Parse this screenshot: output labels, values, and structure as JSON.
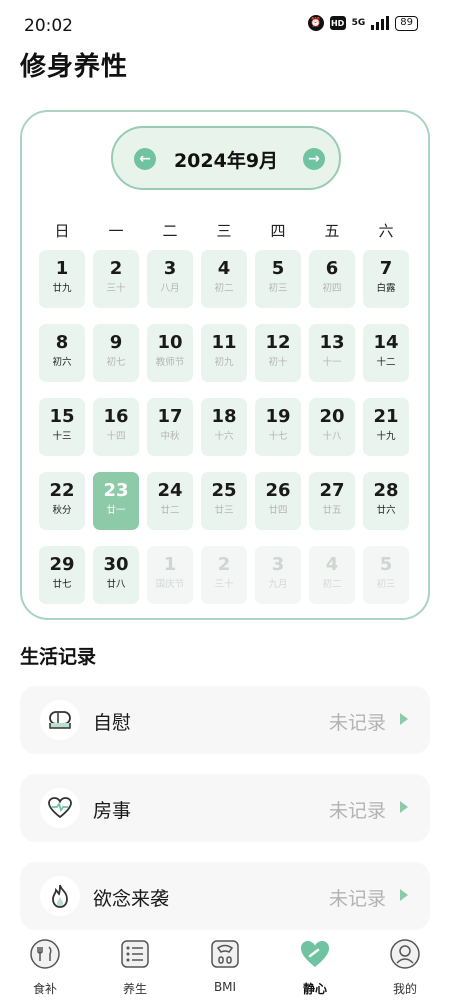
{
  "status_bar": {
    "time": "20:02",
    "hd": "HD",
    "network": "5G",
    "battery": "89"
  },
  "page_title": "修身养性",
  "calendar": {
    "month_label": "2024年9月",
    "weekdays": [
      "日",
      "一",
      "二",
      "三",
      "四",
      "五",
      "六"
    ],
    "weeks": [
      [
        {
          "day": "1",
          "lunar": "廿九"
        },
        {
          "day": "2",
          "lunar": "三十"
        },
        {
          "day": "3",
          "lunar": "八月"
        },
        {
          "day": "4",
          "lunar": "初二"
        },
        {
          "day": "5",
          "lunar": "初三"
        },
        {
          "day": "6",
          "lunar": "初四"
        },
        {
          "day": "7",
          "lunar": "白露"
        }
      ],
      [
        {
          "day": "8",
          "lunar": "初六"
        },
        {
          "day": "9",
          "lunar": "初七"
        },
        {
          "day": "10",
          "lunar": "教师节"
        },
        {
          "day": "11",
          "lunar": "初九"
        },
        {
          "day": "12",
          "lunar": "初十"
        },
        {
          "day": "13",
          "lunar": "十一"
        },
        {
          "day": "14",
          "lunar": "十二"
        }
      ],
      [
        {
          "day": "15",
          "lunar": "十三"
        },
        {
          "day": "16",
          "lunar": "十四"
        },
        {
          "day": "17",
          "lunar": "中秋"
        },
        {
          "day": "18",
          "lunar": "十六"
        },
        {
          "day": "19",
          "lunar": "十七"
        },
        {
          "day": "20",
          "lunar": "十八"
        },
        {
          "day": "21",
          "lunar": "十九"
        }
      ],
      [
        {
          "day": "22",
          "lunar": "秋分"
        },
        {
          "day": "23",
          "lunar": "廿一",
          "selected": true
        },
        {
          "day": "24",
          "lunar": "廿二"
        },
        {
          "day": "25",
          "lunar": "廿三"
        },
        {
          "day": "26",
          "lunar": "廿四"
        },
        {
          "day": "27",
          "lunar": "廿五"
        },
        {
          "day": "28",
          "lunar": "廿六"
        }
      ],
      [
        {
          "day": "29",
          "lunar": "廿七"
        },
        {
          "day": "30",
          "lunar": "廿八"
        },
        {
          "day": "1",
          "lunar": "国庆节",
          "other_month": true
        },
        {
          "day": "2",
          "lunar": "三十",
          "other_month": true
        },
        {
          "day": "3",
          "lunar": "九月",
          "other_month": true
        },
        {
          "day": "4",
          "lunar": "初二",
          "other_month": true
        },
        {
          "day": "5",
          "lunar": "初三",
          "other_month": true
        }
      ]
    ],
    "dark_lunar_days": [
      "1",
      "7",
      "8",
      "14",
      "15",
      "21",
      "22",
      "28",
      "29",
      "30"
    ]
  },
  "section_title": "生活记录",
  "records": [
    {
      "label": "自慰",
      "status": "未记录",
      "icon": "tissue-icon"
    },
    {
      "label": "房事",
      "status": "未记录",
      "icon": "heartbeat-icon"
    },
    {
      "label": "欲念来袭",
      "status": "未记录",
      "icon": "flame-icon"
    }
  ],
  "bottom_nav": [
    {
      "label": "食补",
      "icon": "food-bowl-icon",
      "active": false
    },
    {
      "label": "养生",
      "icon": "list-icon",
      "active": false
    },
    {
      "label": "BMI",
      "icon": "scale-icon",
      "active": false
    },
    {
      "label": "静心",
      "icon": "heart-icon",
      "active": true
    },
    {
      "label": "我的",
      "icon": "profile-icon",
      "active": false
    }
  ],
  "colors": {
    "accent": "#6fc3a0",
    "selected_day": "#8dcaa7",
    "day_cell": "#eaf4ee",
    "card_border": "#a9d4c0"
  }
}
